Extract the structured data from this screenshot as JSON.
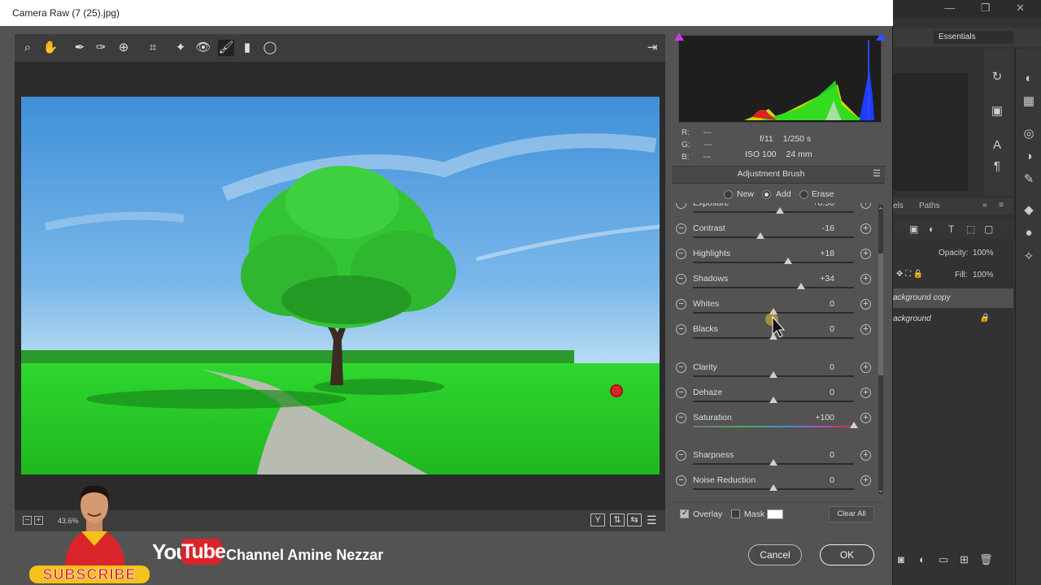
{
  "window_title": "Camera Raw (7 (25).jpg)",
  "photoshop": {
    "workspace": "Essentials",
    "layers_tab": "Paths",
    "layers_tab_prefix": "els",
    "opacity_label": "Opacity:",
    "opacity_value": "100%",
    "fill_label": "Fill:",
    "fill_value": "100%",
    "layers": [
      "ackground copy",
      "ackground"
    ]
  },
  "toolbar": {
    "tools": [
      "zoom-tool",
      "hand-tool",
      "white-balance-tool",
      "color-sampler-tool",
      "targeted-adjustment-tool",
      "crop-tool",
      "spot-removal-tool",
      "red-eye-tool",
      "adjustment-brush-tool",
      "graduated-filter-tool",
      "radial-filter-tool"
    ]
  },
  "status": {
    "zoom": "43.6%"
  },
  "readout": {
    "r_label": "R:",
    "r_value": "---",
    "g_label": "G:",
    "g_value": "---",
    "b_label": "B:",
    "b_value": "---",
    "aperture": "f/11",
    "shutter": "1/250 s",
    "iso": "ISO 100",
    "focal": "24 mm"
  },
  "panel": {
    "title": "Adjustment Brush",
    "modes": [
      {
        "label": "New",
        "selected": false
      },
      {
        "label": "Add",
        "selected": true
      },
      {
        "label": "Erase",
        "selected": false
      }
    ],
    "sliders": [
      {
        "label": "Exposure",
        "value": "+0.50",
        "pos": 0.54
      },
      {
        "label": "Contrast",
        "value": "-16",
        "pos": 0.42
      },
      {
        "label": "Highlights",
        "value": "+18",
        "pos": 0.59
      },
      {
        "label": "Shadows",
        "value": "+34",
        "pos": 0.67
      },
      {
        "label": "Whites",
        "value": "0",
        "pos": 0.5
      },
      {
        "label": "Blacks",
        "value": "0",
        "pos": 0.5
      },
      {
        "label": "Clarity",
        "value": "0",
        "pos": 0.5
      },
      {
        "label": "Dehaze",
        "value": "0",
        "pos": 0.5
      },
      {
        "label": "Saturation",
        "value": "+100",
        "pos": 1.0
      },
      {
        "label": "Sharpness",
        "value": "0",
        "pos": 0.5
      },
      {
        "label": "Noise Reduction",
        "value": "0",
        "pos": 0.5
      }
    ],
    "overlay_label": "Overlay",
    "overlay_checked": true,
    "mask_label": "Mask",
    "mask_checked": false,
    "clear_all": "Clear All"
  },
  "buttons": {
    "cancel": "Cancel",
    "ok": "OK"
  },
  "branding": {
    "you": "You",
    "tube": "Tube",
    "channel": "Channel Amine Nezzar",
    "subscribe": "SUBSCRIBE"
  },
  "colors": {
    "sky": "#4a9de0",
    "grass": "#2fd62f",
    "pin": "#d9252a"
  }
}
